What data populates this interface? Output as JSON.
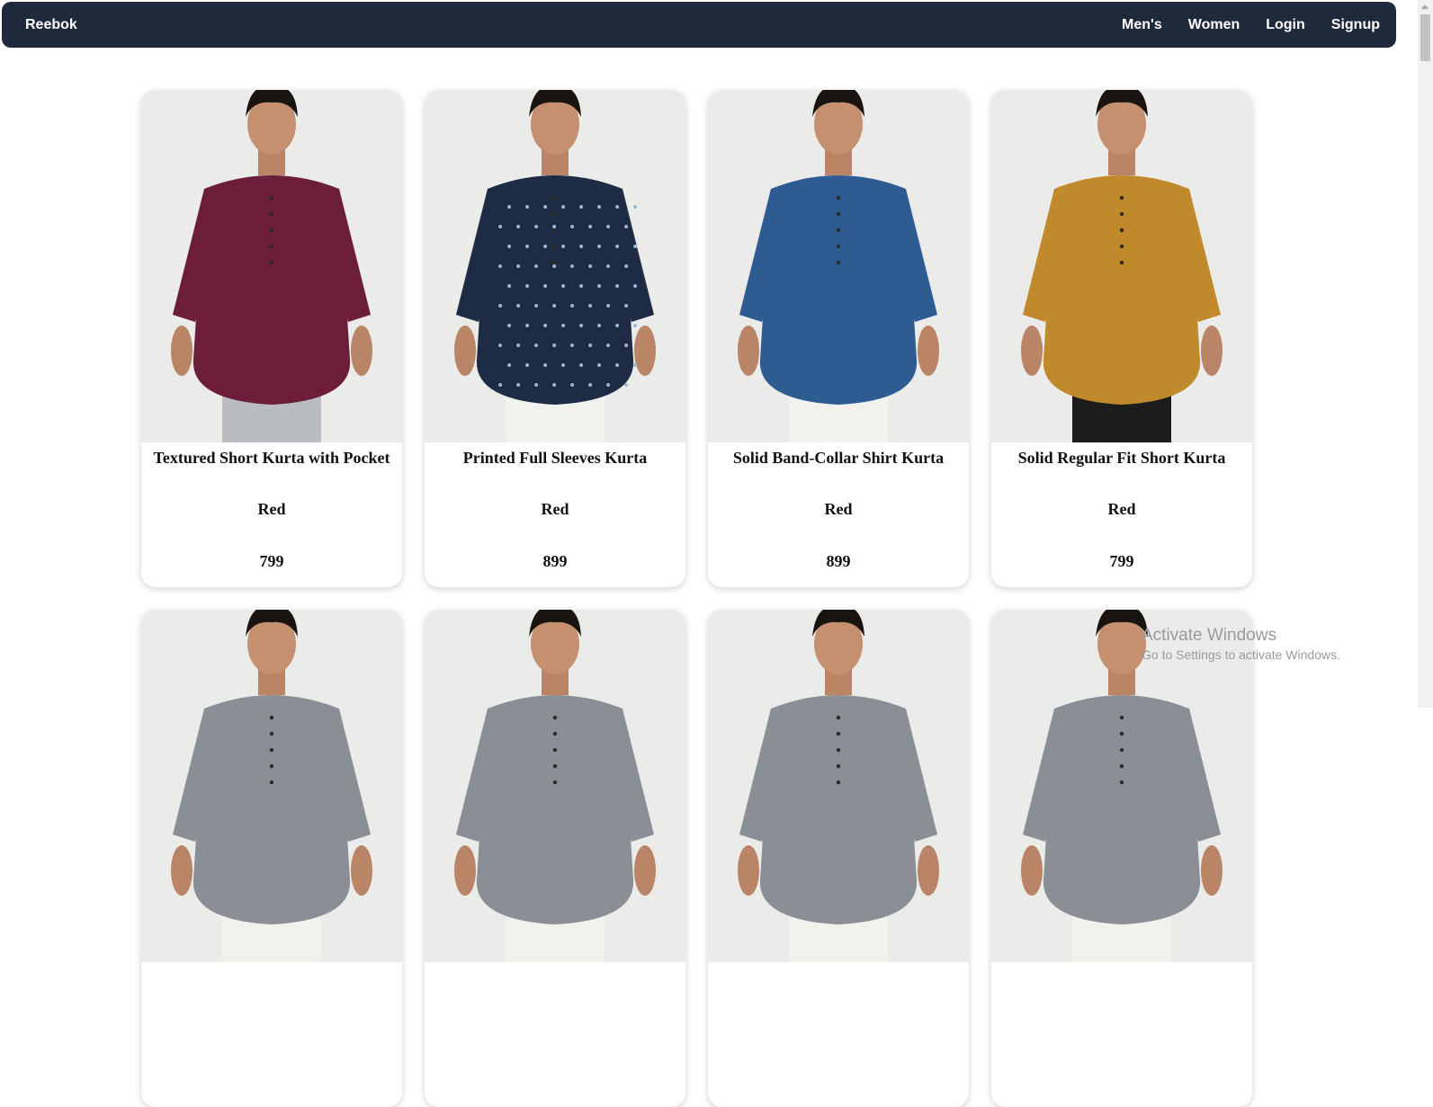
{
  "navbar": {
    "brand": "Reebok",
    "links": [
      "Men's",
      "Women",
      "Login",
      "Signup"
    ]
  },
  "products": [
    {
      "name": "Textured Short Kurta with Pocket",
      "color": "Red",
      "price": "799",
      "shirt_color": "#6b1d3a",
      "pattern": "plain"
    },
    {
      "name": "Printed Full Sleeves Kurta",
      "color": "Red",
      "price": "899",
      "shirt_color": "#1d2b45",
      "pattern": "print"
    },
    {
      "name": "Solid Band-Collar Shirt Kurta",
      "color": "Red",
      "price": "899",
      "shirt_color": "#2e5b92",
      "pattern": "plain"
    },
    {
      "name": "Solid Regular Fit Short Kurta",
      "color": "Red",
      "price": "799",
      "shirt_color": "#c08a2c",
      "pattern": "plain"
    },
    {
      "name": "",
      "color": "",
      "price": "",
      "shirt_color": "#8a8f96",
      "pattern": "plain"
    },
    {
      "name": "",
      "color": "",
      "price": "",
      "shirt_color": "#8a8f96",
      "pattern": "plain"
    },
    {
      "name": "",
      "color": "",
      "price": "",
      "shirt_color": "#8a8f96",
      "pattern": "plain"
    },
    {
      "name": "",
      "color": "",
      "price": "",
      "shirt_color": "#8a8f96",
      "pattern": "plain"
    }
  ],
  "watermark": {
    "title": "Activate Windows",
    "subtitle": "Go to Settings to activate Windows."
  }
}
